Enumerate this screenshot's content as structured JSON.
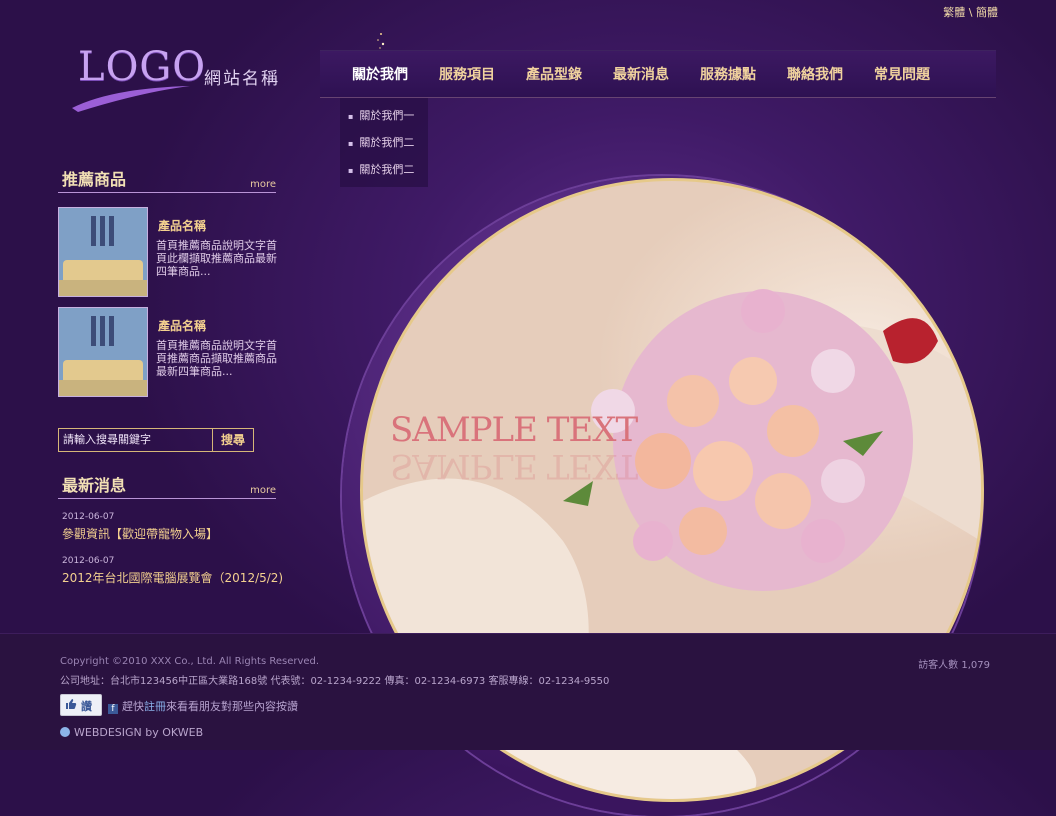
{
  "lang": {
    "traditional": "繁體",
    "separator": "\\",
    "simplified": "簡體"
  },
  "logo": {
    "text": "LOGO",
    "site_name": "網站名稱"
  },
  "nav": {
    "items": [
      "關於我們",
      "服務項目",
      "產品型錄",
      "最新消息",
      "服務據點",
      "聯絡我們",
      "常見問題"
    ],
    "active": "關於我們",
    "dropdown": [
      "關於我們一",
      "關於我們二",
      "關於我們二"
    ]
  },
  "hero": {
    "sample_text": "SAMPLE TEXT"
  },
  "featured": {
    "title": "推薦商品",
    "more": "more",
    "products": [
      {
        "name": "產品名稱",
        "desc": "首頁推薦商品說明文字首頁此欄擷取推薦商品最新四筆商品..."
      },
      {
        "name": "產品名稱",
        "desc": "首頁推薦商品說明文字首頁推薦商品擷取推薦商品最新四筆商品..."
      }
    ]
  },
  "search": {
    "placeholder": "請輸入搜尋關鍵字",
    "button": "搜尋"
  },
  "news": {
    "title": "最新消息",
    "more": "more",
    "items": [
      {
        "date": "2012-06-07",
        "title": "參觀資訊【歡迎帶寵物入場】"
      },
      {
        "date": "2012-06-07",
        "title": "2012年台北國際電腦展覽會（2012/5/2)"
      }
    ]
  },
  "footer": {
    "copyright": "Copyright ©2010 XXX Co., Ltd. All Rights Reserved.",
    "address": "公司地址：台北市123456中正區大業路168號 代表號：02-1234-9222 傳真：02-1234-6973 客服專線：02-1234-9550",
    "visitors": "訪客人數 1,079",
    "like_label": "讚",
    "fb_text_before": "趕快",
    "fb_register": "註冊",
    "fb_text_after": "來看看朋友對那些內容按讚",
    "credit": "WEBDESIGN by OKWEB"
  },
  "colors": {
    "background": "#2c1049",
    "gold": "#f0d29e",
    "accent": "#b994d6"
  }
}
